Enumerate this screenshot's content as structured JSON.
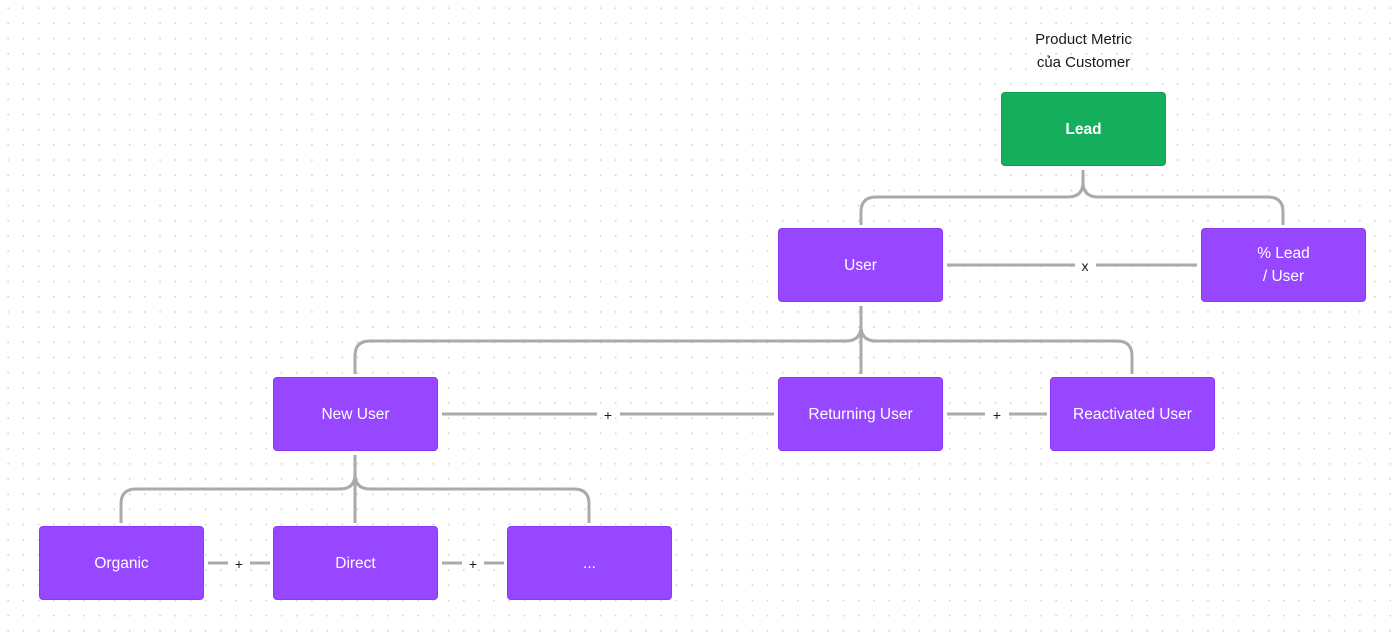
{
  "diagram": {
    "caption_lines": [
      "Product Metric",
      "của Customer"
    ],
    "colors": {
      "root_node": "#14ae5c",
      "child_node": "#9747ff",
      "connector": "#aaaaaa",
      "text_on_node": "#ffffff",
      "operator_text": "#1a1a1a"
    },
    "nodes": {
      "lead": {
        "lines": [
          "Lead"
        ]
      },
      "user": {
        "lines": [
          "User"
        ]
      },
      "lead_per_user": {
        "lines": [
          "% Lead",
          "/ User"
        ]
      },
      "new_user": {
        "lines": [
          "New User"
        ]
      },
      "returning_user": {
        "lines": [
          "Returning User"
        ]
      },
      "reactivated_user": {
        "lines": [
          "Reactivated User"
        ]
      },
      "organic": {
        "lines": [
          "Organic"
        ]
      },
      "direct": {
        "lines": [
          "Direct"
        ]
      },
      "more": {
        "lines": [
          "..."
        ]
      }
    },
    "relations": [
      {
        "parent": "lead",
        "children": [
          "user",
          "lead_per_user"
        ],
        "operators": [
          "x"
        ]
      },
      {
        "parent": "user",
        "children": [
          "new_user",
          "returning_user",
          "reactivated_user"
        ],
        "operators": [
          "+",
          "+"
        ]
      },
      {
        "parent": "new_user",
        "children": [
          "organic",
          "direct",
          "more"
        ],
        "operators": [
          "+",
          "+"
        ]
      }
    ]
  }
}
